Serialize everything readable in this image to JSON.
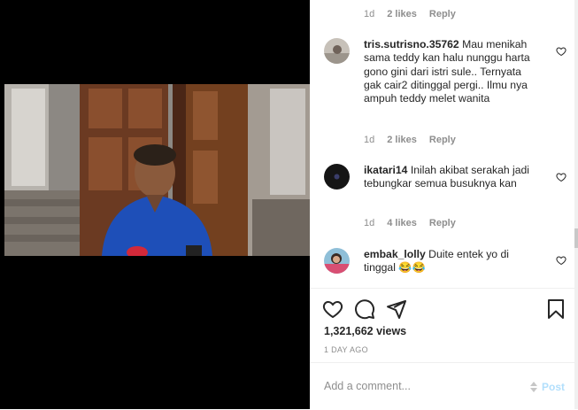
{
  "comments": [
    {
      "username": "",
      "text": "",
      "time": "1d",
      "likes": "2 likes",
      "reply": "Reply"
    },
    {
      "username": "tris.sutrisno.35762",
      "text": "Mau menikah sama teddy kan halu nunggu harta gono gini dari istri sule.. Ternyata gak cair2 ditinggal pergi.. Ilmu nya ampuh teddy melet wanita",
      "time": "1d",
      "likes": "2 likes",
      "reply": "Reply"
    },
    {
      "username": "ikatari14",
      "text": "Inilah akibat serakah jadi tebungkar semua busuknya kan",
      "time": "1d",
      "likes": "4 likes",
      "reply": "Reply"
    },
    {
      "username": "embak_lolly",
      "text": "Duite entek yo di tinggal 😂😂",
      "time": "",
      "likes": "",
      "reply": ""
    }
  ],
  "post": {
    "views": "1,321,662 views",
    "date": "1 DAY AGO"
  },
  "add_comment": {
    "placeholder": "Add a comment...",
    "post_label": "Post"
  },
  "colors": {
    "link": "#b2dffc",
    "muted": "#8e8e8e",
    "text": "#262626"
  },
  "icons": [
    "heart-icon",
    "comment-icon",
    "share-icon",
    "bookmark-icon"
  ]
}
